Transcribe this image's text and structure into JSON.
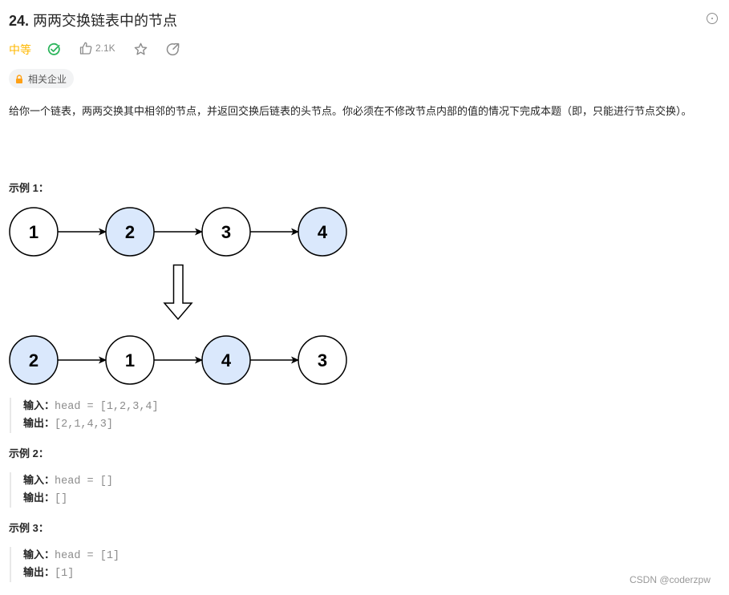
{
  "problem": {
    "number": "24.",
    "title": "两两交换链表中的节点",
    "difficulty": "中等",
    "likes": "2.1K",
    "tag_label": "相关企业",
    "description": "给你一个链表，两两交换其中相邻的节点，并返回交换后链表的头节点。你必须在不修改节点内部的值的情况下完成本题（即，只能进行节点交换）。"
  },
  "icons": {
    "more": "more-horizontal-circle-icon",
    "solved": "check-circle-icon",
    "like": "thumbs-up-icon",
    "star": "star-icon",
    "share": "share-icon",
    "lock": "lock-icon"
  },
  "colors": {
    "difficulty": "#ffb800",
    "solved": "#2db55d",
    "highlight_node": "#dae8fc",
    "lock": "#ffa116"
  },
  "examples": [
    {
      "heading": "示例 1：",
      "diagram": {
        "before": [
          {
            "value": "1",
            "highlight": false
          },
          {
            "value": "2",
            "highlight": true
          },
          {
            "value": "3",
            "highlight": false
          },
          {
            "value": "4",
            "highlight": true
          }
        ],
        "after": [
          {
            "value": "2",
            "highlight": true
          },
          {
            "value": "1",
            "highlight": false
          },
          {
            "value": "4",
            "highlight": true
          },
          {
            "value": "3",
            "highlight": false
          }
        ]
      },
      "input_label": "输入：",
      "input_value": "head = [1,2,3,4]",
      "output_label": "输出：",
      "output_value": "[2,1,4,3]"
    },
    {
      "heading": "示例 2：",
      "input_label": "输入：",
      "input_value": "head = []",
      "output_label": "输出：",
      "output_value": "[]"
    },
    {
      "heading": "示例 3：",
      "input_label": "输入：",
      "input_value": "head = [1]",
      "output_label": "输出：",
      "output_value": "[1]"
    }
  ],
  "watermark": "CSDN @coderzpw"
}
